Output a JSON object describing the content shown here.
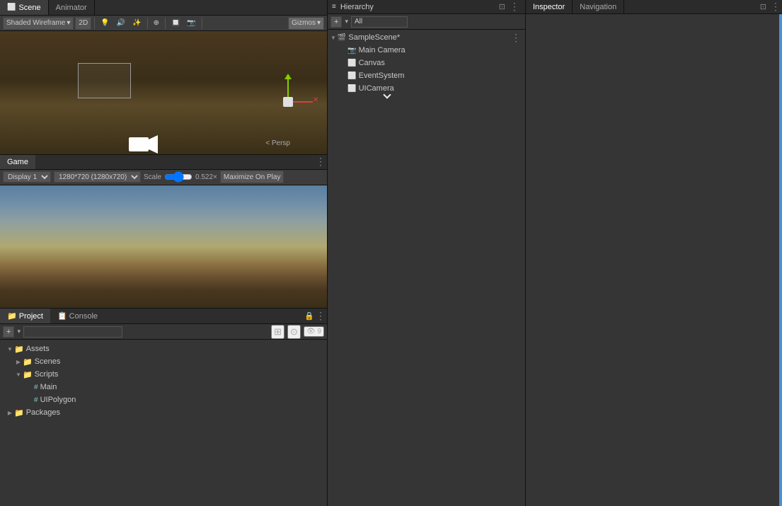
{
  "tabs": {
    "scene": "Scene",
    "animator": "Animator"
  },
  "scene_toolbar": {
    "shading": "Shaded Wireframe",
    "mode_2d": "2D",
    "gizmos": "Gizmos"
  },
  "scene": {
    "persp_label": "< Persp"
  },
  "game_tabs": {
    "game": "Game"
  },
  "game_toolbar": {
    "display": "Display 1",
    "resolution": "1280*720 (1280x720)",
    "scale_label": "Scale",
    "scale_value": "0.522×",
    "maximize": "Maximize On Play"
  },
  "hierarchy": {
    "title": "Hierarchy",
    "filter_placeholder": "All",
    "scene_name": "SampleScene*",
    "items": [
      {
        "name": "Main Camera",
        "indent": 1
      },
      {
        "name": "Canvas",
        "indent": 1
      },
      {
        "name": "EventSystem",
        "indent": 1
      },
      {
        "name": "UICamera",
        "indent": 1
      }
    ]
  },
  "inspector": {
    "title": "Inspector"
  },
  "navigation": {
    "title": "Navigation"
  },
  "project": {
    "title": "Project",
    "console_title": "Console",
    "search_placeholder": "",
    "assets": {
      "label": "Assets",
      "scenes": "Scenes",
      "scripts": "Scripts",
      "main": "Main",
      "ui_polygon": "UIPolygon"
    },
    "packages": "Packages"
  },
  "icons": {
    "folder": "📁",
    "script": "#",
    "camera": "📷",
    "arrow_right": "▶",
    "arrow_down": "▼",
    "lock": "🔒",
    "dots": "⋮",
    "plus": "+",
    "search": "🔍"
  }
}
